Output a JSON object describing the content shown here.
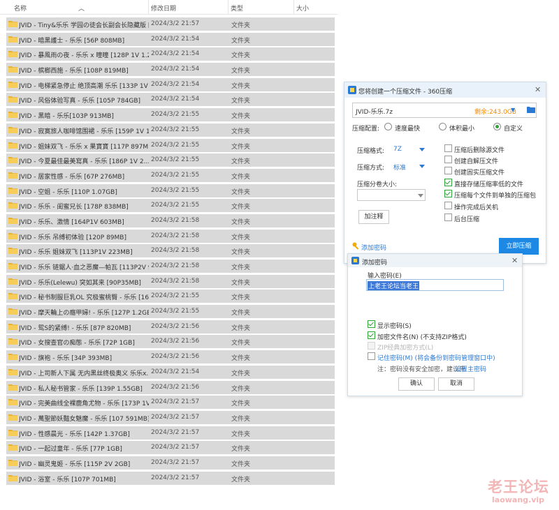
{
  "columns": {
    "name": "名称",
    "date": "修改日期",
    "type": "类型",
    "size": "大小"
  },
  "files": [
    {
      "name": "JVID - Tiny&乐乐 学园の徒会长副会长隐藏版 [...",
      "date": "2024/3/2 21:57",
      "type": "文件夹"
    },
    {
      "name": "JVID - 暗黑護士 - 乐乐 [56P 808MB]",
      "date": "2024/3/2 21:54",
      "type": "文件夹"
    },
    {
      "name": "JVID - 暴風雨の夜 - 乐乐 x 曈曈 [128P 1V 1.2...",
      "date": "2024/3/2 21:54",
      "type": "文件夹"
    },
    {
      "name": "JVID - 槟榔西施 - 乐乐 [108P 819MB]",
      "date": "2024/3/2 21:54",
      "type": "文件夹"
    },
    {
      "name": "JVID - 电梯紧急停止 绝顶高潮 乐乐 [133P 1V ...",
      "date": "2024/3/2 21:54",
      "type": "文件夹"
    },
    {
      "name": "JVID - 风俗体验写真 - 乐乐 [105P 784GB]",
      "date": "2024/3/2 21:54",
      "type": "文件夹"
    },
    {
      "name": "JVID - 黑暗 - 乐乐[103P 913MB]",
      "date": "2024/3/2 21:55",
      "type": "文件夹"
    },
    {
      "name": "JVID - 寂寞旅人咖啡馆围裙 - 乐乐 [159P 1V 1....",
      "date": "2024/3/2 21:55",
      "type": "文件夹"
    },
    {
      "name": "JVID - 姐妹双飞 - 乐乐 x 果寶寶 [117P 897MB]",
      "date": "2024/3/2 21:55",
      "type": "文件夹"
    },
    {
      "name": "JVID - 今夏最佳最美寫真 - 乐乐 [186P 1V 2....",
      "date": "2024/3/2 21:55",
      "type": "文件夹"
    },
    {
      "name": "JVID - 居家性感 - 乐乐 [67P 276MB]",
      "date": "2024/3/2 21:55",
      "type": "文件夹"
    },
    {
      "name": "JVID - 空姐 - 乐乐 [110P 1.07GB]",
      "date": "2024/3/2 21:55",
      "type": "文件夹"
    },
    {
      "name": "JVID - 乐乐 - 闺蜜兄长 [178P 838MB]",
      "date": "2024/3/2 21:55",
      "type": "文件夹"
    },
    {
      "name": "JVID - 乐乐、激情 [164P1V 603MB]",
      "date": "2024/3/2 21:58",
      "type": "文件夹"
    },
    {
      "name": "JVID - 乐乐 吊缚初体验 [120P 89MB]",
      "date": "2024/3/2 21:58",
      "type": "文件夹"
    },
    {
      "name": "JVID - 乐乐 姐妹双飞 [113P1V 223MB]",
      "date": "2024/3/2 21:58",
      "type": "文件夹"
    },
    {
      "name": "JVID - 乐乐 链鋸人·血之恶魔—帕瓦 [113P2V 9...",
      "date": "2024/3/2 21:58",
      "type": "文件夹"
    },
    {
      "name": "JVID - 乐乐(Lelewu) 突如其来 [90P35MB]",
      "date": "2024/3/2 21:58",
      "type": "文件夹"
    },
    {
      "name": "JVID - 秘书制服巨乳OL 究极蜜桃臀 - 乐乐 [16...",
      "date": "2024/3/2 21:55",
      "type": "文件夹"
    },
    {
      "name": "JVID - 摩天輪上の癮甲婦! - 乐乐 [127P 1.2GB]",
      "date": "2024/3/2 21:55",
      "type": "文件夹"
    },
    {
      "name": "JVID - 鸳S的紧缚! - 乐乐 [87P 820MB]",
      "date": "2024/3/2 21:56",
      "type": "文件夹"
    },
    {
      "name": "JVID - 女搜查官の痴態 - 乐乐 [72P 1GB]",
      "date": "2024/3/2 21:56",
      "type": "文件夹"
    },
    {
      "name": "JVID - 旗袍 - 乐乐 [34P 393MB]",
      "date": "2024/3/2 21:56",
      "type": "文件夹"
    },
    {
      "name": "JVID - 上司新人下属 无内黑丝终极奥义 乐乐x...",
      "date": "2024/3/2 21:54",
      "type": "文件夹"
    },
    {
      "name": "JVID - 私人秘书管家 - 乐乐 [139P 1.55GB]",
      "date": "2024/3/2 21:56",
      "type": "文件夹"
    },
    {
      "name": "JVID - 完美曲线全裸鹿角尤物 - 乐乐 [173P 1V ...",
      "date": "2024/3/2 21:57",
      "type": "文件夹"
    },
    {
      "name": "JVID - 萬聖節妖豔女魅魔 - 乐乐 [107 591MB]",
      "date": "2024/3/2 21:57",
      "type": "文件夹"
    },
    {
      "name": "JVID - 性感晨光 - 乐乐 [142P 1.37GB]",
      "date": "2024/3/2 21:57",
      "type": "文件夹"
    },
    {
      "name": "JVID - 一起过童年 - 乐乐 [77P 1GB]",
      "date": "2024/3/2 21:57",
      "type": "文件夹"
    },
    {
      "name": "JVID - 幽灵鬼姬 - 乐乐 [115P 2V 2GB]",
      "date": "2024/3/2 21:57",
      "type": "文件夹"
    },
    {
      "name": "JVID - 浴室 - 乐乐 [107P 701MB]",
      "date": "2024/3/2 21:57",
      "type": "文件夹"
    }
  ],
  "compress": {
    "title": "您将创建一个压缩文件 - 360压缩",
    "filename": "JVID-乐乐.7z",
    "remaining": "剩余:243.0GB",
    "config_label": "压缩配置:",
    "opt_fast": "速度最快",
    "opt_small": "体积最小",
    "opt_custom": "自定义",
    "format_label": "压缩格式:",
    "format_value": "7Z",
    "method_label": "压缩方式:",
    "method_value": "标准",
    "split_label": "压缩分卷大小:",
    "comment_btn": "加注释",
    "chk_delete": "压缩后删除源文件",
    "chk_sfx": "创建自解压文件",
    "chk_solid": "创建固实压缩文件",
    "chk_store": "直接存储压缩率低的文件",
    "chk_each": "压缩每个文件到单独的压缩包",
    "chk_shutdown": "操作完成后关机",
    "chk_background": "后台压缩",
    "add_password": "添加密码",
    "start_btn": "立即压缩"
  },
  "password": {
    "title": "添加密码",
    "input_label": "输入密码(E)",
    "value": "上老王论坛当老王",
    "show_pwd": "显示密码(S)",
    "encrypt_names": "加密文件名(N) (不支持ZIP格式)",
    "zip_legacy": "ZIP经典加密方式(L)",
    "remember": "记住密码(M) (将会备份到密码管理窗口中)",
    "note_prefix": "注：密码没有安全加密，建议先",
    "note_link": "设置主密码",
    "ok": "确认",
    "cancel": "取消"
  },
  "watermark": {
    "cn": "老王论坛",
    "url": "laowang.vip"
  },
  "colors": {
    "accent": "#1e88e5",
    "check": "#2fa53a",
    "warn": "#f08a00",
    "folder": "#f2c14e"
  }
}
